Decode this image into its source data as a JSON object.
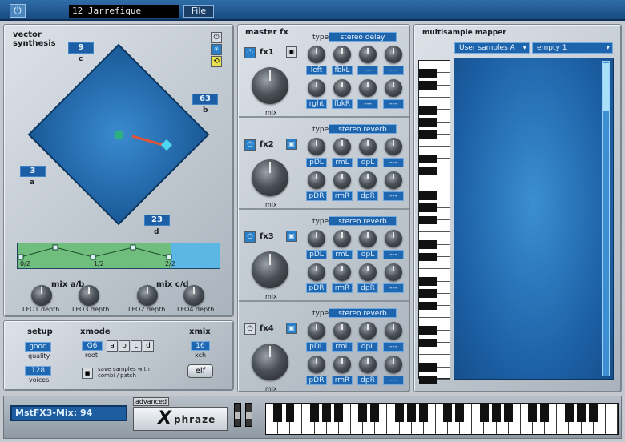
{
  "topbar": {
    "patch_name": "12 Jarrefique",
    "file_button": "File"
  },
  "vector": {
    "title_line1": "vector",
    "title_line2": "synthesis",
    "c_value": "9",
    "c_label": "c",
    "b_value": "63",
    "b_label": "b",
    "a_value": "3",
    "a_label": "a",
    "d_value": "23",
    "d_label": "d",
    "env_ticks": [
      "0/2",
      "1/2",
      "2/2"
    ]
  },
  "mix_ab": {
    "title": "mix a/b",
    "knob1": "LFO1 depth",
    "knob2": "LFO3 depth"
  },
  "mix_cd": {
    "title": "mix c/d",
    "knob1": "LFO2 depth",
    "knob2": "LFO4 depth"
  },
  "setup": {
    "title": "setup",
    "quality_value": "good",
    "quality_label": "quality",
    "voices_value": "128",
    "voices_label": "voices"
  },
  "xmode": {
    "title": "xmode",
    "root_value": "G6",
    "root_label": "root",
    "buttons": [
      "a",
      "b",
      "c",
      "d"
    ],
    "save_text": "save samples with combi / patch"
  },
  "xmix": {
    "title": "xmix",
    "xch_value": "16",
    "xch_label": "xch",
    "elf_button": "elf"
  },
  "master_fx": {
    "title": "master fx",
    "type_label": "type",
    "mix_label": "mix",
    "fx": [
      {
        "name": "fx1",
        "type": "stereo delay",
        "row1": [
          "left",
          "fbkL",
          "---",
          "---"
        ],
        "row2": [
          "rght",
          "fbkR",
          "---",
          "---"
        ]
      },
      {
        "name": "fx2",
        "type": "stereo reverb",
        "row1": [
          "pDL",
          "rmL",
          "dpL",
          "---"
        ],
        "row2": [
          "pDR",
          "rmR",
          "dpR",
          "---"
        ]
      },
      {
        "name": "fx3",
        "type": "stereo reverb",
        "row1": [
          "pDL",
          "rmL",
          "dpL",
          "---"
        ],
        "row2": [
          "pDR",
          "rmR",
          "dpR",
          "---"
        ]
      },
      {
        "name": "fx4",
        "type": "stereo reverb",
        "row1": [
          "pDL",
          "rmL",
          "dpL",
          "---"
        ],
        "row2": [
          "pDR",
          "rmR",
          "dpR",
          "---"
        ]
      }
    ]
  },
  "mapper": {
    "title": "multisample mapper",
    "bank_select": "User samples A",
    "sample_select": "empty 1"
  },
  "bottom": {
    "status": "MstFX3-Mix: 94",
    "advanced_tab": "advanced",
    "logo_x": "X",
    "logo_text": "phraze"
  },
  "colors": {
    "accent_blue": "#1f67b0",
    "panel_grey": "#c7ced5",
    "vector_blue": "#1b63a8"
  }
}
